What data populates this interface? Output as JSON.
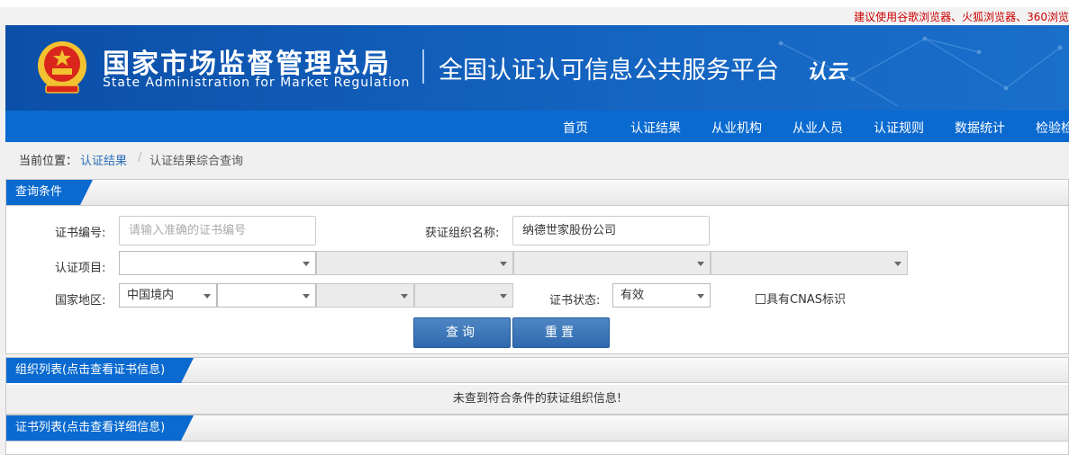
{
  "browser_tip": "建议使用谷歌浏览器、火狐浏览器、360浏览",
  "header": {
    "org_cn": "国家市场监督管理总局",
    "org_en": "State Administration  for  Market Regulation",
    "platform": "全国认证认可信息公共服务平台",
    "logo_text": "认云"
  },
  "nav": [
    "首页",
    "认证结果",
    "从业机构",
    "从业人员",
    "认证规则",
    "数据统计",
    "检验检"
  ],
  "breadcrumb": {
    "prefix": "当前位置：",
    "link": "认证结果",
    "sep": "/",
    "current": "认证结果综合查询"
  },
  "query": {
    "title": "查询条件",
    "cert_no_label": "证书编号:",
    "cert_no_placeholder": "请输入准确的证书编号",
    "org_name_label": "获证组织名称:",
    "org_name_value": "纳德世家股份公司",
    "project_label": "认证项目:",
    "region_label": "国家地区:",
    "region_value": "中国境内",
    "status_label": "证书状态:",
    "status_value": "有效",
    "cnas_label": "具有CNAS标识",
    "search_btn": "查询",
    "reset_btn": "重置"
  },
  "org_list": {
    "title": "组织列表(点击查看证书信息)",
    "empty": "未查到符合条件的获证组织信息!"
  },
  "cert_list": {
    "title": "证书列表(点击查看详细信息)"
  },
  "colors": {
    "nav_blue": "#0a6ad0",
    "banner_blue": "#0b4fa8",
    "tip_red": "#cc0000"
  }
}
